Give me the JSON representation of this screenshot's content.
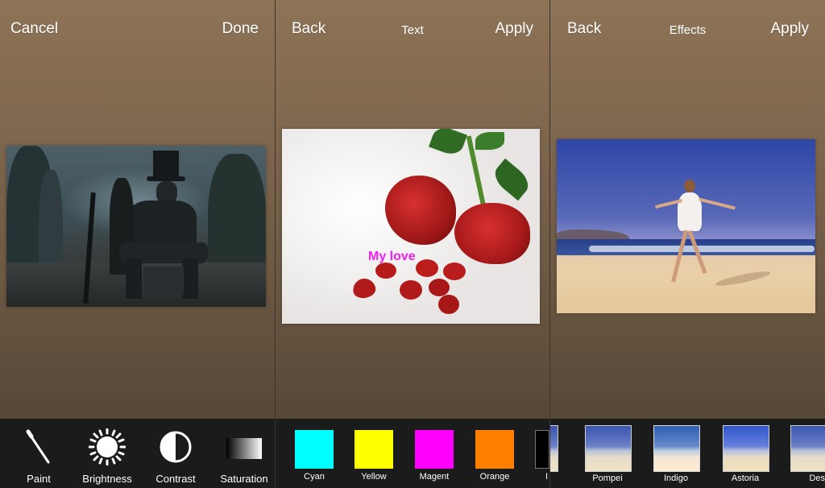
{
  "panel1": {
    "nav": {
      "left": "Cancel",
      "right": "Done"
    },
    "tools": [
      {
        "label": "Paint",
        "icon": "paint-brush-icon"
      },
      {
        "label": "Brightness",
        "icon": "sun-icon"
      },
      {
        "label": "Contrast",
        "icon": "contrast-icon"
      },
      {
        "label": "Saturation",
        "icon": "saturation-gradient-icon"
      }
    ]
  },
  "panel2": {
    "nav": {
      "left": "Back",
      "title": "Text",
      "right": "Apply"
    },
    "overlay_text": "My love",
    "overlay_color": "#f21ef0",
    "colors": [
      {
        "label": "Cyan",
        "hex": "#00ffff"
      },
      {
        "label": "Yellow",
        "hex": "#ffff00"
      },
      {
        "label": "Magent",
        "hex": "#ff00ff"
      },
      {
        "label": "Orange",
        "hex": "#ff8000"
      },
      {
        "label": "I",
        "hex": "#000000"
      }
    ]
  },
  "panel3": {
    "nav": {
      "left": "Back",
      "title": "Effects",
      "right": "Apply"
    },
    "effects": [
      {
        "label": "Pompei"
      },
      {
        "label": "Indigo"
      },
      {
        "label": "Astoria"
      },
      {
        "label": "Des"
      }
    ]
  }
}
